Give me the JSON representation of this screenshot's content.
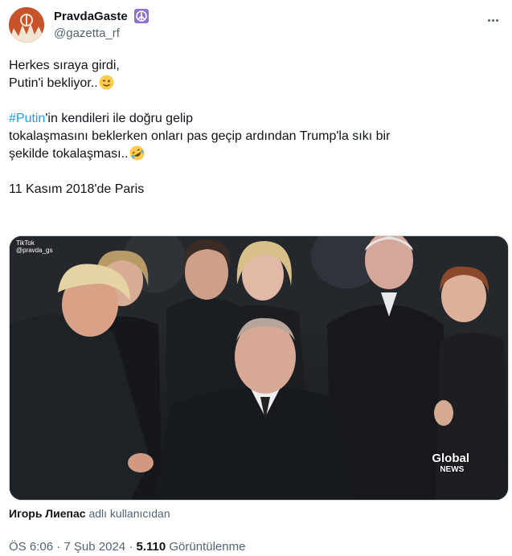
{
  "author": {
    "display_name": "PravdaGaste",
    "handle": "@gazetta_rf",
    "badge_icon": "peace-symbol-icon"
  },
  "tweet": {
    "line1": "Herkes sıraya girdi,",
    "line2": "Putin'i bekliyor..",
    "line2_emoji": "winking-face-emoji",
    "hashtag": "#Putin",
    "line3_rest": "'in kendileri ile doğru gelip",
    "line4": "tokalaşmasını beklerken onları pas geçip ardından Trump'la sıkı bir",
    "line5": "şekilde tokalaşması..",
    "line5_emoji": "rolling-on-floor-laughing-emoji",
    "line6": "11 Kasım 2018'de Paris"
  },
  "media": {
    "watermark_top": "TikTok",
    "watermark_handle": "@pravda_gs",
    "logo_line1": "Global",
    "logo_line2": "NEWS"
  },
  "credit": {
    "name": "Игорь Лиепас",
    "suffix": "adlı kullanıcıdan"
  },
  "meta": {
    "time": "ÖS 6:06",
    "sep1": "·",
    "date": "7 Şub 2024",
    "sep2": "·",
    "views": "5.110",
    "views_label": "Görüntülenme"
  },
  "colors": {
    "link": "#1d9bf0",
    "secondary_text": "#536471",
    "primary_text": "#0f1419"
  }
}
